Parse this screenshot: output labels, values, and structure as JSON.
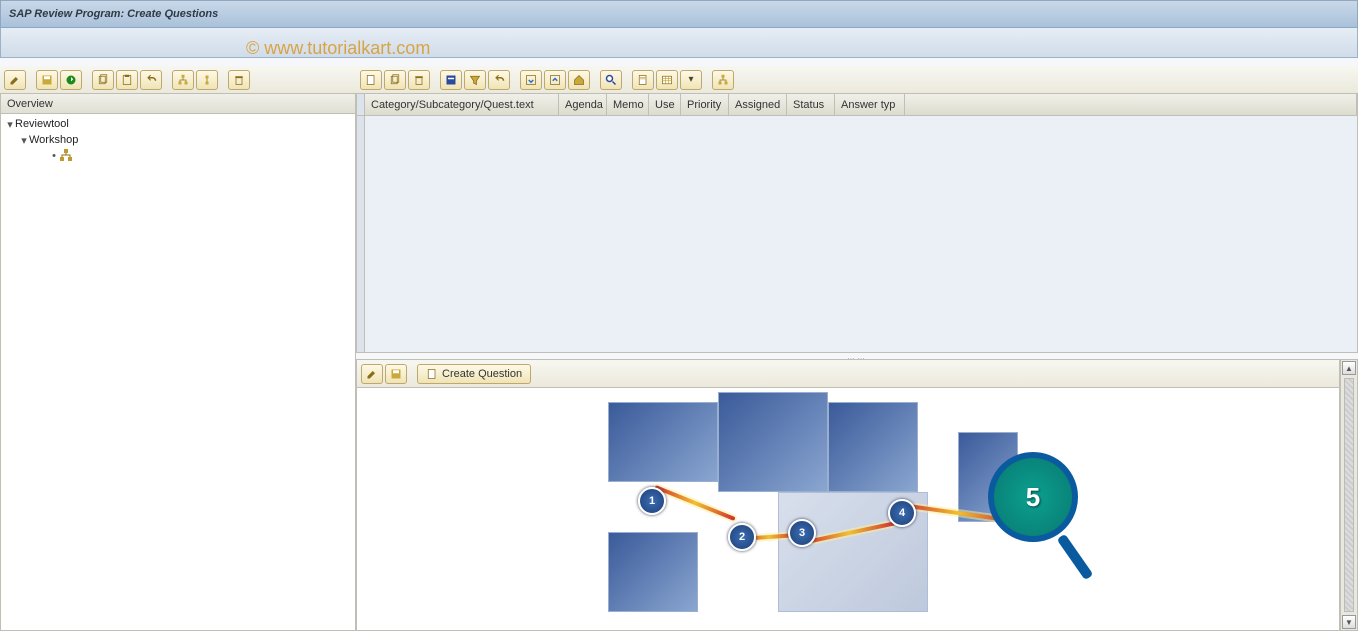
{
  "title": "SAP Review Program: Create Questions",
  "watermark": "© www.tutorialkart.com",
  "tree": {
    "header": "Overview",
    "root": "Reviewtool",
    "child": "Workshop"
  },
  "columns": {
    "c1": "Category/Subcategory/Quest.text",
    "c2": "Agenda",
    "c3": "Memo",
    "c4": "Use",
    "c5": "Priority",
    "c6": "Assigned",
    "c7": "Status",
    "c8": "Answer typ"
  },
  "lower": {
    "create_label": "Create Question"
  },
  "nodes": {
    "n1": "1",
    "n2": "2",
    "n3": "3",
    "n4": "4",
    "n5": "5"
  }
}
